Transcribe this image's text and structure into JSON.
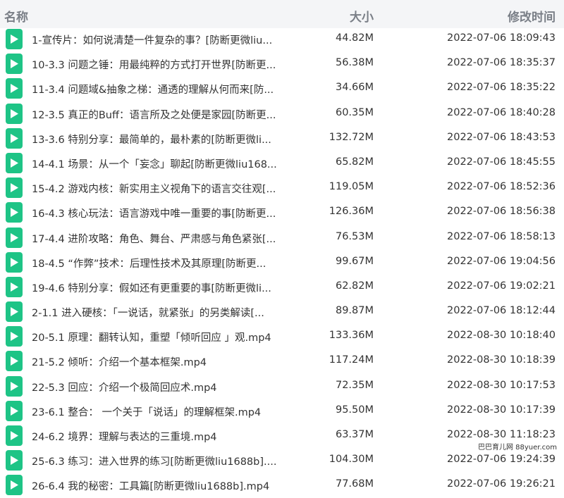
{
  "header": {
    "name_label": "名称",
    "size_label": "大小",
    "time_label": "修改时间"
  },
  "colors": {
    "icon_green": "#1ec486",
    "header_bg": "#f4f5f7",
    "header_text": "#7a7f87"
  },
  "icon": "video-file-icon",
  "files": [
    {
      "name": "1-宣传片：如何说清楚一件复杂的事？[防断更微liu...",
      "size": "44.82M",
      "time": "2022-07-06 18:09:43"
    },
    {
      "name": "10-3.3 问题之锤：用最纯粹的方式打开世界[防断更...",
      "size": "56.38M",
      "time": "2022-07-06 18:35:37"
    },
    {
      "name": "11-3.4 问题域&抽象之梯：通透的理解从何而来[防...",
      "size": "34.66M",
      "time": "2022-07-06 18:35:22"
    },
    {
      "name": "12-3.5 真正的Buff：语言所及之处便是家园[防断更...",
      "size": "60.35M",
      "time": "2022-07-06 18:40:28"
    },
    {
      "name": "13-3.6 特别分享：最简单的，最朴素的[防断更微li...",
      "size": "132.72M",
      "time": "2022-07-06 18:43:53"
    },
    {
      "name": "14-4.1 场景：从一个「妄念」聊起[防断更微liu168...",
      "size": "65.82M",
      "time": "2022-07-06 18:45:55"
    },
    {
      "name": "15-4.2 游戏内核：新实用主义视角下的语言交往观[...",
      "size": "119.05M",
      "time": "2022-07-06 18:52:36"
    },
    {
      "name": "16-4.3 核心玩法：语言游戏中唯一重要的事[防断更...",
      "size": "126.36M",
      "time": "2022-07-06 18:56:38"
    },
    {
      "name": "17-4.4 进阶攻略：角色、舞台、严肃感与角色紧张[...",
      "size": "76.53M",
      "time": "2022-07-06 18:58:13"
    },
    {
      "name": "18-4.5 “作弊”技术：后理性技术及其原理[防断更...",
      "size": "99.67M",
      "time": "2022-07-06 19:04:56"
    },
    {
      "name": "19-4.6 特别分享：假如还有更重要的事[防断更微li...",
      "size": "62.82M",
      "time": "2022-07-06 19:02:21"
    },
    {
      "name": "2-1.1 进入硬核：「一说话，就紧张」的另类解读[...",
      "size": "89.87M",
      "time": "2022-07-06 18:12:44"
    },
    {
      "name": "20-5.1 原理：翻转认知，重塑「倾听回应 」观.mp4",
      "size": "133.36M",
      "time": "2022-08-30 10:18:40"
    },
    {
      "name": "21-5.2 倾听：介绍一个基本框架.mp4",
      "size": "117.24M",
      "time": "2022-08-30 10:18:39"
    },
    {
      "name": "22-5.3 回应：介绍一个极简回应术.mp4",
      "size": "72.35M",
      "time": "2022-08-30 10:17:53"
    },
    {
      "name": "23-6.1 整合： 一个关于「说话」的理解框架.mp4",
      "size": "95.50M",
      "time": "2022-08-30 10:17:39"
    },
    {
      "name": "24-6.2 境界：理解与表达的三重境.mp4",
      "size": "63.37M",
      "time": "2022-08-30 11:18:23"
    },
    {
      "name": "25-6.3 练习：进入世界的练习[防断更微liu1688b]....",
      "size": "104.30M",
      "time": "2022-07-06 19:24:39"
    },
    {
      "name": "26-6.4 我的秘密：工具篇[防断更微liu1688b].mp4",
      "size": "77.68M",
      "time": "2022-07-06 19:26:21"
    }
  ],
  "watermark": "巴巴育儿网 88yuer.com"
}
